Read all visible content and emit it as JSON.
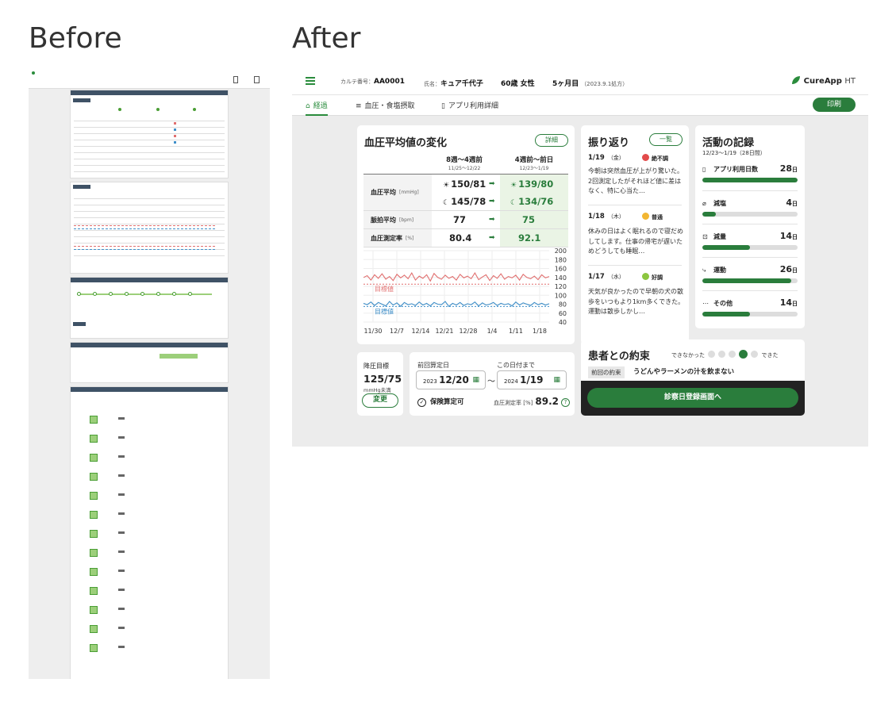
{
  "labels": {
    "before": "Before",
    "after": "After"
  },
  "header": {
    "chart_no_label": "カルテ番号：",
    "chart_no": "AA0001",
    "name_label": "氏名：",
    "name": "キュア千代子",
    "age_sex": "60歳 女性",
    "month": "5ヶ月目",
    "since": "（2023.9.1処方）",
    "brand": "CureApp",
    "brand_suffix": "HT"
  },
  "tabs": [
    {
      "icon": "⌂",
      "label": "経過"
    },
    {
      "icon": "≡",
      "label": "血圧・食塩摂取"
    },
    {
      "icon": "▯",
      "label": "アプリ利用詳細"
    }
  ],
  "print_label": "印刷",
  "bp": {
    "title": "血圧平均値の変化",
    "detail": "詳細",
    "col1": "8週〜4週前",
    "col1_sub": "11/25〜12/22",
    "col2": "4週前〜前日",
    "col2_sub": "12/23〜1/19",
    "row_bp": "血圧平均",
    "row_bp_unit": "[mmHg]",
    "morning_before": "150/81",
    "morning_after": "139/80",
    "evening_before": "145/78",
    "evening_after": "134/76",
    "row_pulse": "脈拍平均",
    "row_pulse_unit": "[bpm]",
    "pulse_before": "77",
    "pulse_after": "75",
    "row_rate": "血圧測定率",
    "row_rate_unit": "[%]",
    "rate_before": "80.4",
    "rate_after": "92.1"
  },
  "chart_data": {
    "type": "line",
    "x_ticks": [
      "11/30",
      "12/7",
      "12/14",
      "12/21",
      "12/28",
      "1/4",
      "1/11",
      "1/18"
    ],
    "y_ticks": [
      40,
      60,
      80,
      100,
      120,
      140,
      160,
      180,
      200
    ],
    "ylim": [
      40,
      200
    ],
    "target_label": "目標値",
    "target_sys": 125,
    "target_dia": 75,
    "series": [
      {
        "color": "#e16f6f",
        "values": [
          140,
          144,
          134,
          146,
          138,
          148,
          136,
          142,
          133,
          147,
          139,
          145,
          137,
          150,
          134,
          143,
          138,
          146,
          132,
          149,
          140,
          136,
          145,
          138,
          142,
          134,
          147,
          139,
          143,
          137,
          150,
          135,
          141,
          146,
          133,
          144,
          138,
          148,
          136,
          142,
          139,
          145,
          134,
          147,
          140,
          137,
          143,
          135,
          146,
          139,
          142
        ]
      },
      {
        "color": "#3f8fc9",
        "values": [
          82,
          79,
          85,
          77,
          84,
          80,
          76,
          86,
          78,
          83,
          75,
          84,
          79,
          81,
          77,
          85,
          78,
          82,
          76,
          84,
          80,
          79,
          86,
          75,
          82,
          78,
          84,
          77,
          81,
          79,
          85,
          76,
          83,
          78,
          80,
          84,
          77,
          82,
          79,
          81,
          76,
          85,
          78,
          83,
          80,
          77,
          84,
          79,
          82,
          78,
          81
        ]
      }
    ]
  },
  "goal": {
    "label": "降圧目標",
    "value": "125/75",
    "unit": "mmHg未満",
    "button": "変更"
  },
  "calc": {
    "from_label": "前回算定日",
    "to_label": "この日付まで",
    "from_year": "2023",
    "from_date": "12/20",
    "to_year": "2024",
    "to_date": "1/19",
    "check": "保険算定可",
    "rate_label": "血圧測定率",
    "rate_unit": "[%]",
    "rate": "89.2"
  },
  "refl": {
    "title": "振り返り",
    "list": "一覧",
    "entries": [
      {
        "date": "1/19",
        "dow": "（金）",
        "mood": "絶不調",
        "mood_color": "#e24b4b",
        "text": "今朝は突然血圧が上がり驚いた。2回測定したがそれほど値に差はなく、特に心当た…"
      },
      {
        "date": "1/18",
        "dow": "（木）",
        "mood": "普通",
        "mood_color": "#f2b632",
        "text": "休みの日はよく眠れるので寝だめしてします。仕事の帰宅が遅いためどうしても睡眠…"
      },
      {
        "date": "1/17",
        "dow": "（水）",
        "mood": "好調",
        "mood_color": "#8cc63f",
        "text": "天気が良かったので早朝の犬の散歩をいつもより1km多くできた。運動は散歩しかし…"
      }
    ]
  },
  "activity": {
    "title": "活動の記録",
    "period": "12/23〜1/19（28日間）",
    "unit": "日",
    "rows": [
      {
        "icon": "▯",
        "name": "アプリ利用日数",
        "days": "28",
        "fraction": 1.0
      },
      {
        "icon": "⌀",
        "name": "減塩",
        "days": "4",
        "fraction": 0.14
      },
      {
        "icon": "⊡",
        "name": "減量",
        "days": "14",
        "fraction": 0.5
      },
      {
        "icon": "⤷",
        "name": "運動",
        "days": "26",
        "fraction": 0.93
      },
      {
        "icon": "⋯",
        "name": "その他",
        "days": "14",
        "fraction": 0.5
      }
    ]
  },
  "promise": {
    "title": "患者との約束",
    "scale_left": "できなかった",
    "scale_right": "できた",
    "scale_selected": 4,
    "tag": "前回の約束",
    "text": "うどんやラーメンの汁を飲まない",
    "button": "診察日登録画面へ"
  }
}
